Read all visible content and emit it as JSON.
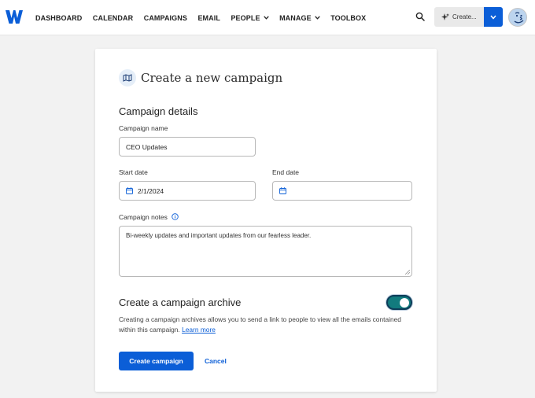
{
  "nav": {
    "items": [
      {
        "label": "DASHBOARD",
        "dropdown": false
      },
      {
        "label": "CALENDAR",
        "dropdown": false
      },
      {
        "label": "CAMPAIGNS",
        "dropdown": false
      },
      {
        "label": "EMAIL",
        "dropdown": false
      },
      {
        "label": "PEOPLE",
        "dropdown": true
      },
      {
        "label": "MANAGE",
        "dropdown": true
      },
      {
        "label": "TOOLBOX",
        "dropdown": false
      }
    ],
    "create_label": "Create...",
    "brand_color": "#0b5ed7"
  },
  "form": {
    "title": "Create a new campaign",
    "section_title": "Campaign details",
    "name_label": "Campaign name",
    "name_value": "CEO Updates",
    "start_label": "Start date",
    "start_value": "2/1/2024",
    "end_label": "End date",
    "end_value": "",
    "notes_label": "Campaign notes",
    "notes_value": "Bi-weekly updates and important updates from our fearless leader.",
    "archive_title": "Create a campaign archive",
    "archive_enabled": true,
    "archive_desc": "Creating a campaign archives allows you to send a link to people to view all the emails contained within this campaign.",
    "learn_more": "Learn more",
    "submit_label": "Create campaign",
    "cancel_label": "Cancel"
  },
  "icons": {
    "logo": "w-logo-icon",
    "search": "search-icon",
    "sparkle": "sparkle-icon",
    "dropdown": "chevron-down-icon",
    "avatar": "avatar",
    "campaign": "map-icon",
    "calendar": "calendar-icon",
    "info": "info-icon",
    "resize": "resize-handle-icon"
  },
  "colors": {
    "primary": "#0b5ed7",
    "toggle_on": "#127b7e",
    "page_bg": "#f2f2f2"
  }
}
